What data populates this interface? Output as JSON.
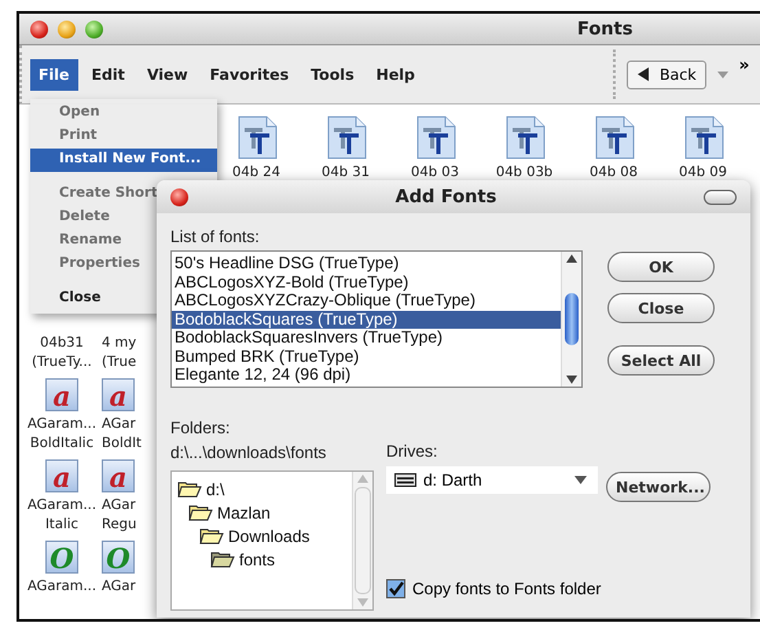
{
  "window": {
    "title": "Fonts"
  },
  "menubar": [
    {
      "label": "File",
      "selected": true
    },
    {
      "label": "Edit",
      "selected": false
    },
    {
      "label": "View",
      "selected": false
    },
    {
      "label": "Favorites",
      "selected": false
    },
    {
      "label": "Tools",
      "selected": false
    },
    {
      "label": "Help",
      "selected": false
    }
  ],
  "toolbar": {
    "back": "Back",
    "overflow": "»"
  },
  "file_menu": [
    {
      "kind": "item",
      "label": "Open",
      "disabled": true,
      "selected": false
    },
    {
      "kind": "item",
      "label": "Print",
      "disabled": true,
      "selected": false
    },
    {
      "kind": "item",
      "label": "Install New Font...",
      "disabled": false,
      "selected": true
    },
    {
      "kind": "separator"
    },
    {
      "kind": "item",
      "label": "Create Short",
      "disabled": true,
      "selected": false
    },
    {
      "kind": "item",
      "label": "Delete",
      "disabled": true,
      "selected": false
    },
    {
      "kind": "item",
      "label": "Rename",
      "disabled": true,
      "selected": false
    },
    {
      "kind": "item",
      "label": "Properties",
      "disabled": true,
      "selected": false
    },
    {
      "kind": "separator"
    },
    {
      "kind": "item",
      "label": "Close",
      "disabled": false,
      "selected": false
    }
  ],
  "top_icons": [
    {
      "label": "04b 24"
    },
    {
      "label": "04b 31"
    },
    {
      "label": "04b 03"
    },
    {
      "label": "04b 03b"
    },
    {
      "label": "04b 08"
    },
    {
      "label": "04b 09"
    }
  ],
  "left_icons": [
    {
      "lines": [
        "04b31",
        "(TrueTy..."
      ]
    },
    {
      "lines": [
        "4 my",
        "(True"
      ]
    },
    {
      "glyph": "a",
      "color": "#c0202a",
      "lines": [
        "AGaram...",
        "BoldItalic"
      ]
    },
    {
      "glyph": "a",
      "color": "#c0202a",
      "lines": [
        "AGar",
        "BoldIt"
      ]
    },
    {
      "glyph": "a",
      "color": "#c0202a",
      "lines": [
        "AGaram...",
        "Italic"
      ]
    },
    {
      "glyph": "a",
      "color": "#c0202a",
      "lines": [
        "AGar",
        "Regu"
      ]
    },
    {
      "glyph": "O",
      "color": "#1e8a2a",
      "lines": [
        "AGaram..."
      ]
    },
    {
      "glyph": "O",
      "color": "#1e8a2a",
      "lines": [
        "AGar"
      ]
    }
  ],
  "dialog": {
    "title": "Add Fonts",
    "list_label": "List of fonts:",
    "fonts": [
      {
        "label": "50's Headline DSG (TrueType)",
        "selected": false
      },
      {
        "label": "ABCLogosXYZ-Bold (TrueType)",
        "selected": false
      },
      {
        "label": "ABCLogosXYZCrazy-Oblique (TrueType)",
        "selected": false
      },
      {
        "label": "BodoblackSquares (TrueType)",
        "selected": true
      },
      {
        "label": "BodoblackSquaresInvers (TrueType)",
        "selected": false
      },
      {
        "label": "Bumped BRK (TrueType)",
        "selected": false
      },
      {
        "label": "Elegante 12, 24 (96 dpi)",
        "selected": false
      }
    ],
    "buttons": [
      "OK",
      "Close",
      "Select All"
    ],
    "folders_label": "Folders:",
    "folder_path": "d:\\...\\downloads\\fonts",
    "folders": [
      {
        "label": "d:\\",
        "selected": false,
        "children": [
          {
            "label": "Mazlan",
            "selected": false,
            "children": [
              {
                "label": "Downloads",
                "selected": false,
                "children": [
                  {
                    "label": "fonts",
                    "selected": true
                  }
                ]
              }
            ]
          }
        ]
      }
    ],
    "drives_label": "Drives:",
    "drive": "d: Darth",
    "network_button": "Network...",
    "copy_checkbox": {
      "label": "Copy fonts to Fonts folder",
      "checked": true
    }
  }
}
